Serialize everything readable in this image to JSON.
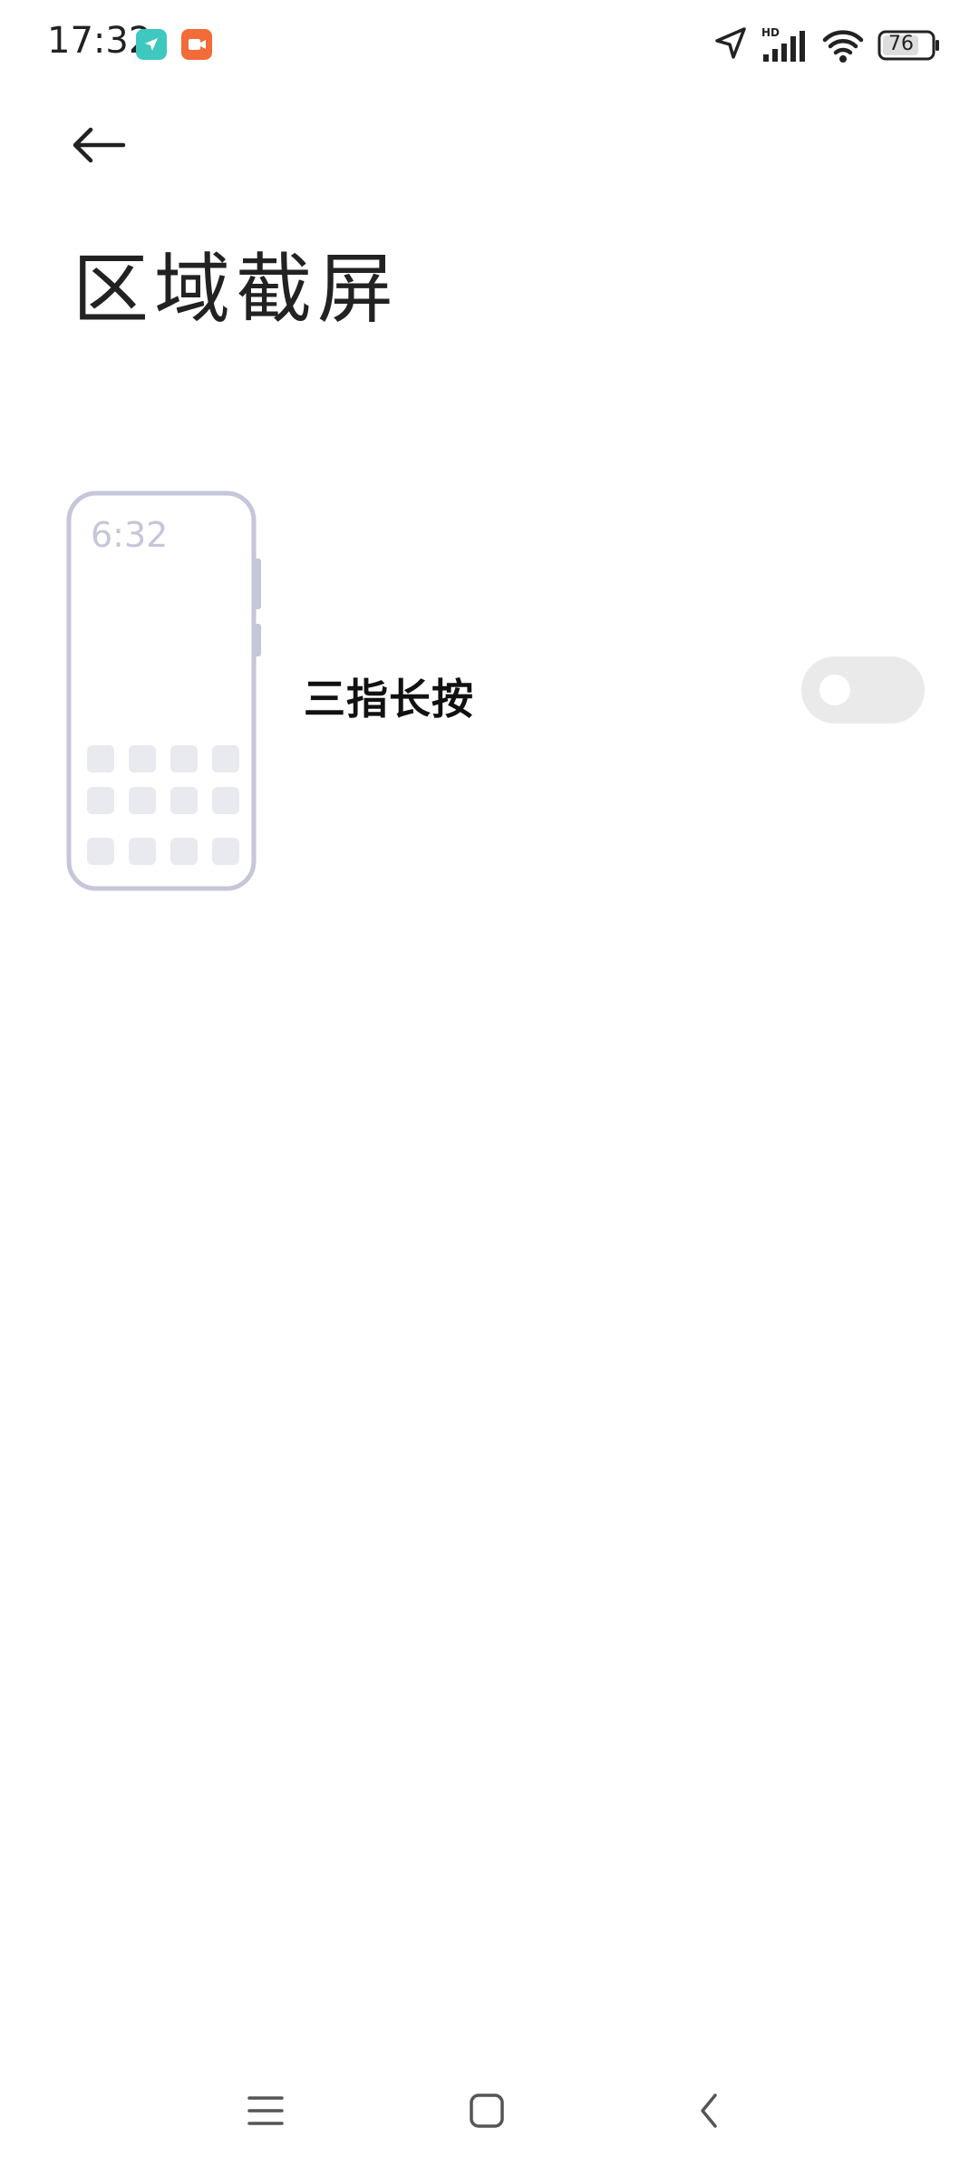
{
  "status_bar": {
    "time": "17:32",
    "battery": "76",
    "signal_label": "HD",
    "icons": [
      "navigation-app-icon",
      "recorder-app-icon",
      "location-arrow-icon",
      "hd-signal-icon",
      "wifi-icon",
      "battery-icon"
    ],
    "colors": {
      "nav_badge": "#3ec8c0",
      "rec_badge": "#f26b38"
    }
  },
  "header": {
    "back_icon": "arrow-left-icon",
    "title": "区域截屏"
  },
  "illustration": {
    "clock": "6:32"
  },
  "settings": {
    "three_finger_press": {
      "label": "三指长按",
      "enabled": false
    }
  },
  "nav_bar": {
    "icons": [
      "menu-icon",
      "home-icon",
      "back-chevron-icon"
    ]
  }
}
